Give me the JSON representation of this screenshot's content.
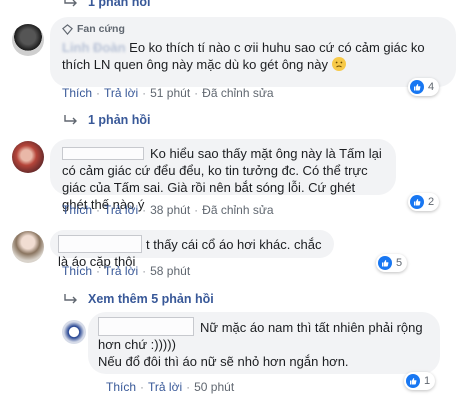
{
  "top": {
    "reply_label": "1 phản hồi"
  },
  "comment1": {
    "badge": "Fan cứng",
    "name": "Linh Đoàn",
    "text": "Eo ko thích tí nào c ơii huhu sao cứ có cảm giác ko thích LN quen ông này mặc dù ko gét ông này",
    "emoji": "sad-face-emoji",
    "actions": {
      "like": "Thích",
      "reply": "Trả lời",
      "time": "51 phút",
      "edited": "Đã chỉnh sửa"
    },
    "reactions": "4",
    "replies_label": "1 phản hồi"
  },
  "comment2": {
    "text": "Ko hiểu sao thấy mặt ông này là Tấm lại có cảm giác cứ đểu đểu, ko tin tưởng đc. Có thể trực giác của Tấm sai. Già rồi nên bắt sóng lỗi. Cứ ghét ghét thế nào ý",
    "actions": {
      "like": "Thích",
      "reply": "Trả lời",
      "time": "38 phút",
      "edited": "Đã chỉnh sửa"
    },
    "reactions": "2"
  },
  "comment3": {
    "text": "t thấy cái cổ áo hơi khác. chắc là áo cặp thôi",
    "actions": {
      "like": "Thích",
      "reply": "Trả lời",
      "time": "58 phút"
    },
    "reactions": "5"
  },
  "more_replies": "Xem thêm 5 phản hồi",
  "reply1": {
    "text_line1": "Nữ mặc áo nam thì tất nhiên phải rộng",
    "text_line2": "hơn chứ :)))))",
    "text_line3": "Nếu đổ đôi thì áo nữ sẽ nhỏ hơn ngắn hơn.",
    "actions": {
      "like": "Thích",
      "reply": "Trả lời",
      "time": "50 phút"
    },
    "reactions": "1"
  },
  "colors": {
    "link": "#385898",
    "bubble": "#f2f3f5",
    "like": "#1877f2",
    "meta": "#606770"
  }
}
